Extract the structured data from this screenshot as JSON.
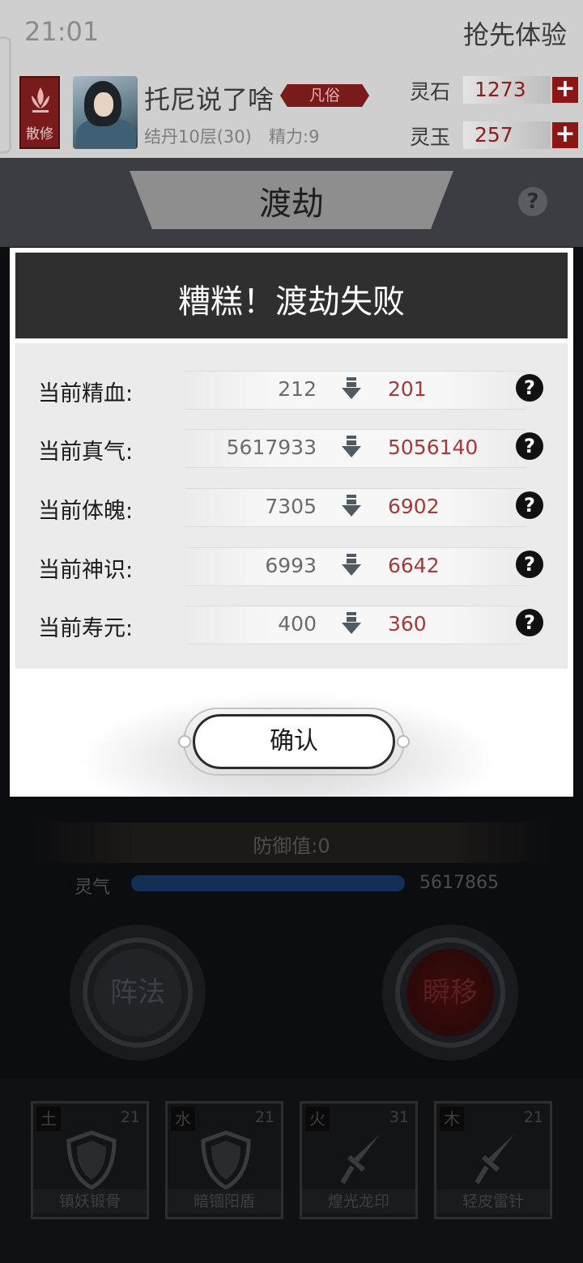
{
  "status": {
    "time": "21:01",
    "early_access": "抢先体验"
  },
  "player": {
    "sect_label": "散修",
    "name": "托尼说了啥",
    "rank": "凡俗",
    "realm": "结丹10层(30)",
    "energy": "精力:9"
  },
  "resources": [
    {
      "label": "灵石",
      "value": "1273"
    },
    {
      "label": "灵玉",
      "value": "257"
    }
  ],
  "screen": {
    "title": "渡劫",
    "help_glyph": "?"
  },
  "modal": {
    "title": "糟糕！渡劫失败",
    "stats": [
      {
        "label": "当前精血:",
        "old": "212",
        "new": "201"
      },
      {
        "label": "当前真气:",
        "old": "5617933",
        "new": "5056140"
      },
      {
        "label": "当前体魄:",
        "old": "7305",
        "new": "6902"
      },
      {
        "label": "当前神识:",
        "old": "6993",
        "new": "6642"
      },
      {
        "label": "当前寿元:",
        "old": "400",
        "new": "360"
      }
    ],
    "help_glyph": "?",
    "confirm_label": "确认"
  },
  "battle": {
    "defense": "防御值:0",
    "qi_label": "灵气",
    "qi_value": "5617865",
    "qi_fill": 1.0,
    "formation_label": "阵法",
    "blink_label": "瞬移"
  },
  "skills": [
    {
      "element": "土",
      "count": "21",
      "name": "镇妖锻骨",
      "icon": "shield-icon"
    },
    {
      "element": "水",
      "count": "21",
      "name": "暗锢阳盾",
      "icon": "shield-icon"
    },
    {
      "element": "火",
      "count": "31",
      "name": "煌光龙印",
      "icon": "sword-icon"
    },
    {
      "element": "木",
      "count": "21",
      "name": "轻皮雷针",
      "icon": "sword-icon"
    }
  ],
  "colors": {
    "accent_red": "#8c1616",
    "value_red": "#a53a3a",
    "header_dark": "#2f2f2f"
  }
}
